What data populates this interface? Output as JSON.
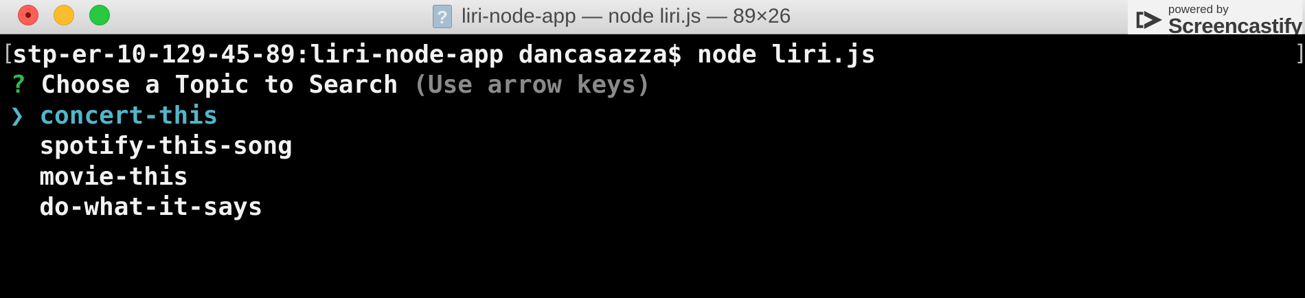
{
  "window": {
    "title": "liri-node-app — node liri.js — 89×26",
    "doc_icon_glyph": "?"
  },
  "watermark": {
    "powered": "powered by",
    "brand": "Screencastify"
  },
  "terminal": {
    "prompt_command": "stp-er-10-129-45-89:liri-node-app dancasazza$ node liri.js",
    "question_mark": "?",
    "question": "Choose a Topic to Search",
    "hint": "(Use arrow keys)",
    "pointer": "❯",
    "options": [
      "concert-this",
      "spotify-this-song",
      "movie-this",
      "do-what-it-says"
    ],
    "selected_index": 0,
    "bracket_left": "[",
    "bracket_right": "]"
  },
  "colors": {
    "background": "#000000",
    "text": "#f2f2f2",
    "selected": "#52b6c9",
    "question_mark": "#2fbb4f",
    "hint": "#8a8a8a"
  }
}
